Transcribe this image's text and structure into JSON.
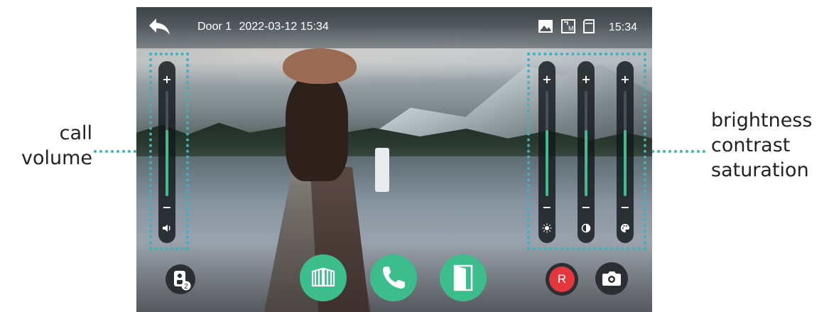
{
  "annotations": {
    "left": [
      "call",
      "volume"
    ],
    "right": [
      "brightness",
      "contrast",
      "saturation"
    ]
  },
  "header": {
    "door_name": "Door 1",
    "datetime": "2022-03-12 15:34",
    "clock": "15:34",
    "back_icon": "back-arrow-icon",
    "status_icons": [
      "picture-icon",
      "video-memo-icon",
      "sd-card-icon"
    ],
    "status_icon_memo_letter": "M"
  },
  "sliders": {
    "volume": {
      "plus": "+",
      "minus": "−",
      "icon": "speaker-icon",
      "level": 0.63
    },
    "brightness": {
      "plus": "+",
      "minus": "−",
      "icon": "sun-icon",
      "level": 0.63
    },
    "contrast": {
      "plus": "+",
      "minus": "−",
      "icon": "contrast-icon",
      "level": 0.63
    },
    "saturation": {
      "plus": "+",
      "minus": "−",
      "icon": "palette-icon",
      "level": 0.63
    }
  },
  "buttons": {
    "monitor_switch": {
      "icon": "camera-unit-icon",
      "badge": "2"
    },
    "gate": {
      "icon": "gate-icon"
    },
    "answer": {
      "icon": "phone-icon"
    },
    "door": {
      "icon": "door-icon"
    },
    "record": {
      "label": "R",
      "icon": "record-icon"
    },
    "snapshot": {
      "icon": "camera-icon"
    }
  },
  "colors": {
    "accent_green": "#3dbc8c",
    "annotation_dots": "#3ab3bd",
    "record_red": "#e3373d"
  }
}
